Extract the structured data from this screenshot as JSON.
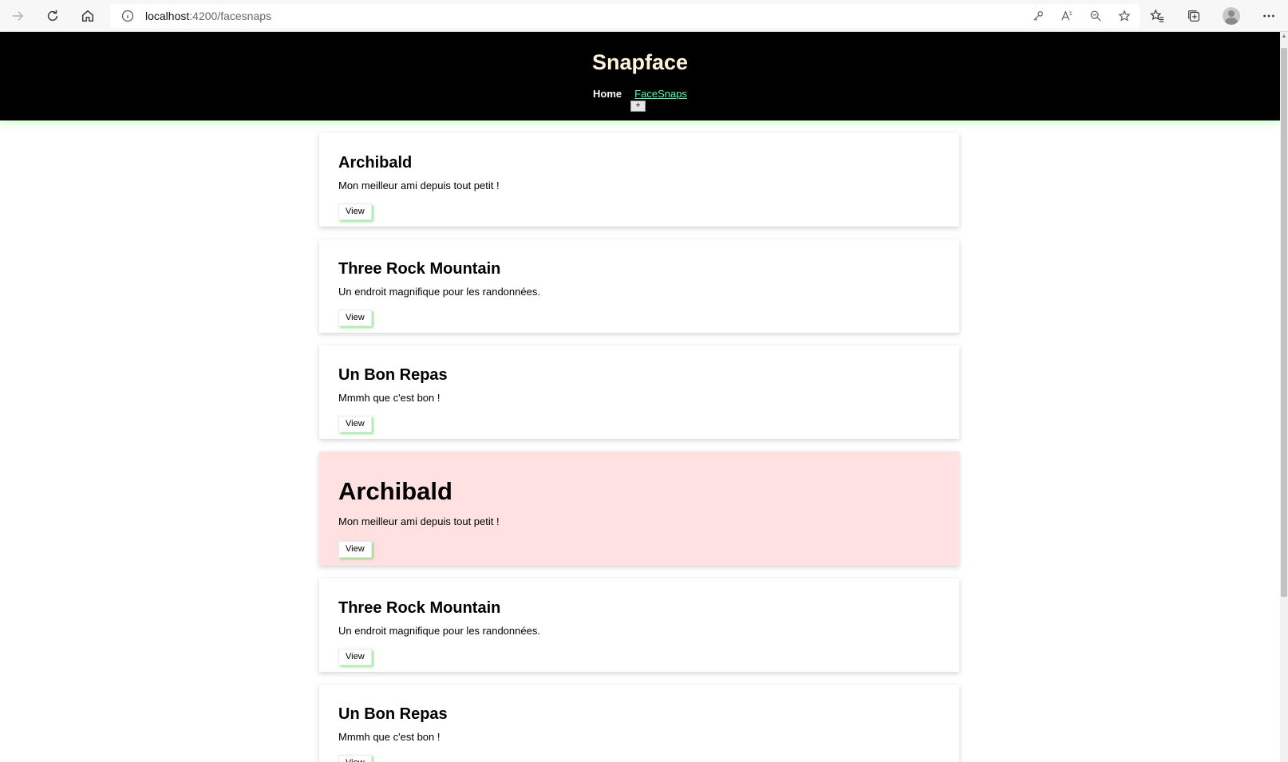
{
  "browser": {
    "url_host": "localhost",
    "url_path": ":4200/facesnaps"
  },
  "header": {
    "title": "Snapface",
    "nav": {
      "home": "Home",
      "facesnaps": "FaceSnaps",
      "add": "+"
    }
  },
  "cards": [
    {
      "title": "Archibald",
      "description": "Mon meilleur ami depuis tout petit !",
      "button": "View"
    },
    {
      "title": "Three Rock Mountain",
      "description": "Un endroit magnifique pour les randonnées.",
      "button": "View"
    },
    {
      "title": "Un Bon Repas",
      "description": "Mmmh que c'est bon !",
      "button": "View"
    },
    {
      "title": "Archibald",
      "description": "Mon meilleur ami depuis tout petit !",
      "button": "View"
    },
    {
      "title": "Three Rock Mountain",
      "description": "Un endroit magnifique pour les randonnées.",
      "button": "View"
    },
    {
      "title": "Un Bon Repas",
      "description": "Mmmh que c'est bon !",
      "button": "View"
    }
  ],
  "colors": {
    "header_bg": "#000000",
    "title": "#fff3dc",
    "active_link": "#4dffb0",
    "highlight_card": "#ffe1e1",
    "button_shadow": "#50d250"
  }
}
